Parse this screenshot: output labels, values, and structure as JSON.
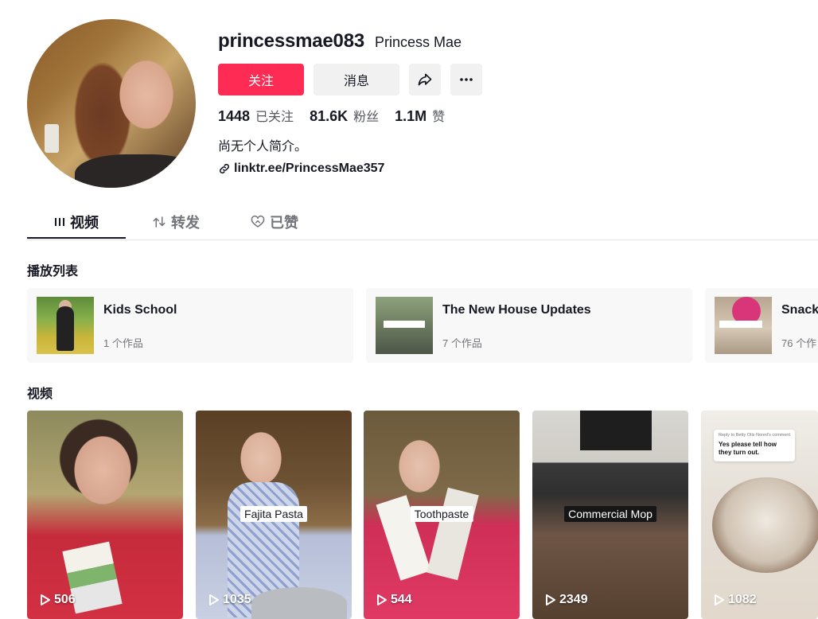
{
  "profile": {
    "username": "princessmae083",
    "nickname": "Princess Mae",
    "follow_label": "关注",
    "message_label": "消息",
    "stats": {
      "following_value": "1448",
      "following_label": "已关注",
      "followers_value": "81.6K",
      "followers_label": "粉丝",
      "likes_value": "1.1M",
      "likes_label": "赞"
    },
    "bio": "尚无个人简介。",
    "link": "linktr.ee/PrincessMae357"
  },
  "tabs": [
    {
      "label": "视频",
      "icon": "grid-icon",
      "active": true
    },
    {
      "label": "转发",
      "icon": "repost-icon",
      "active": false
    },
    {
      "label": "已赞",
      "icon": "liked-heart-icon",
      "active": false
    }
  ],
  "playlists_title": "播放列表",
  "playlists": [
    {
      "name": "Kids School",
      "count": "1 个作品"
    },
    {
      "name": "The New House Updates",
      "count": "7 个作品"
    },
    {
      "name": "Snack",
      "count": "76 个作"
    }
  ],
  "videos_title": "视频",
  "videos": [
    {
      "caption": "",
      "plays": "506"
    },
    {
      "caption": "Fajita Pasta",
      "plays": "1035"
    },
    {
      "caption": "Toothpaste",
      "plays": "544"
    },
    {
      "caption": "Commercial Mop",
      "plays": "2349"
    },
    {
      "caption": "",
      "plays": "1082",
      "comment_header": "Reply to Betty Otis Nored's comment",
      "comment_text": "Yes please tell how they turn out."
    }
  ],
  "colors": {
    "accent": "#fe2c55",
    "button_gray": "#f1f1f2",
    "text_primary": "#161823",
    "text_secondary": "#73747b"
  }
}
